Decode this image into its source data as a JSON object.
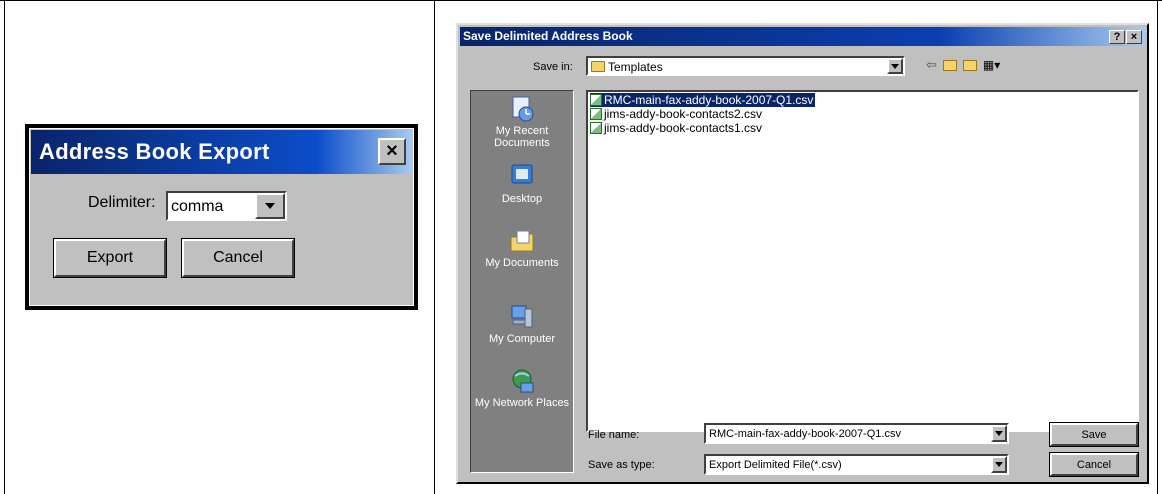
{
  "address_export": {
    "title": "Address Book Export",
    "close_label": "×",
    "delimiter_label": "Delimiter:",
    "delimiter_value": "comma",
    "export_label": "Export",
    "cancel_label": "Cancel"
  },
  "save_dialog": {
    "title": "Save Delimited Address Book",
    "help_label": "?",
    "close_label": "×",
    "save_in_label": "Save in:",
    "save_in_value": "Templates",
    "places": [
      {
        "label": "My Recent Documents",
        "icon": "recent-documents-icon"
      },
      {
        "label": "Desktop",
        "icon": "desktop-icon"
      },
      {
        "label": "My Documents",
        "icon": "my-documents-icon"
      },
      {
        "label": "My Computer",
        "icon": "my-computer-icon"
      },
      {
        "label": "My Network Places",
        "icon": "network-places-icon"
      }
    ],
    "files": [
      {
        "name": "RMC-main-fax-addy-book-2007-Q1.csv",
        "selected": true
      },
      {
        "name": "jims-addy-book-contacts2.csv",
        "selected": false
      },
      {
        "name": "jims-addy-book-contacts1.csv",
        "selected": false
      }
    ],
    "file_name_label": "File name:",
    "file_name_value": "RMC-main-fax-addy-book-2007-Q1.csv",
    "save_as_type_label": "Save as type:",
    "save_as_type_value": "Export Delimited File(*.csv)",
    "save_label": "Save",
    "cancel_label": "Cancel"
  },
  "colors": {
    "titlebar": "#0a246a",
    "dialog_face": "#c0c0c0",
    "selection": "#0a246a",
    "places_bar": "#808080"
  }
}
